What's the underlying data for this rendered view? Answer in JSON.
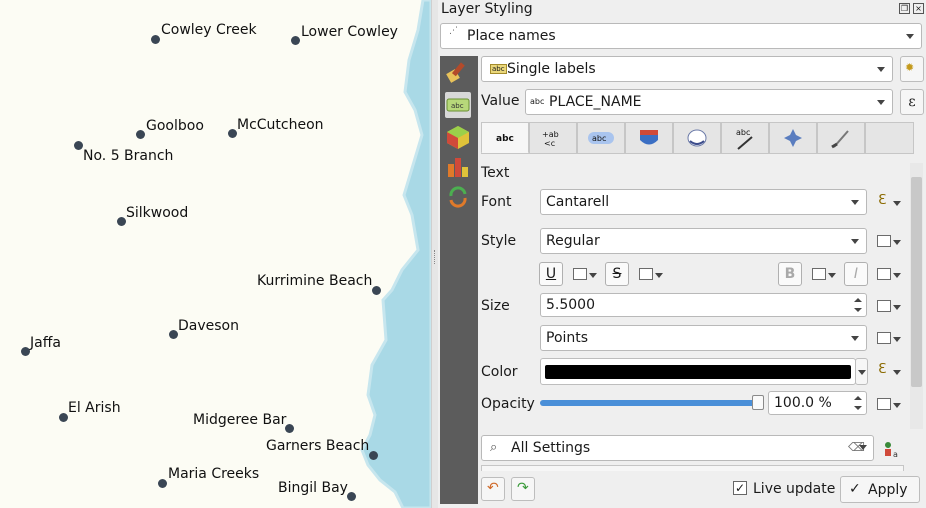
{
  "map": {
    "places": [
      {
        "name": "Cowley Creek"
      },
      {
        "name": "Lower Cowley"
      },
      {
        "name": "Goolboo"
      },
      {
        "name": "McCutcheon"
      },
      {
        "name": "No. 5 Branch"
      },
      {
        "name": "Silkwood"
      },
      {
        "name": "Kurrimine Beach"
      },
      {
        "name": "Daveson"
      },
      {
        "name": "Jaffa"
      },
      {
        "name": "El Arish"
      },
      {
        "name": "Midgeree Bar"
      },
      {
        "name": "Garners Beach"
      },
      {
        "name": "Maria Creeks"
      },
      {
        "name": "Bingil Bay"
      }
    ],
    "colors": {
      "land": "#fcfcf4",
      "water": "#a9d9e6",
      "dot": "#3a4654"
    }
  },
  "panel": {
    "title": "Layer Styling",
    "layer_combo": "Place names",
    "mode_combo": "Single labels",
    "value_label": "Value",
    "value_field": "PLACE_NAME",
    "value_field_icon": "abc",
    "expression_symbol": "ε",
    "tabs": [
      {
        "name": "text",
        "icon": "abc"
      },
      {
        "name": "formatting",
        "icon": "+ab"
      },
      {
        "name": "buffer",
        "icon": "abc"
      },
      {
        "name": "mask",
        "icon": "shield-icon"
      },
      {
        "name": "background",
        "icon": "background-icon"
      },
      {
        "name": "shadow",
        "icon": "abc"
      },
      {
        "name": "callouts",
        "icon": "callout-icon"
      },
      {
        "name": "placement",
        "icon": "placement-icon"
      },
      {
        "name": "rendering",
        "icon": "brush-icon"
      }
    ],
    "text_section": {
      "heading": "Text",
      "font_label": "Font",
      "font_value": "Cantarell",
      "style_label": "Style",
      "style_value": "Regular",
      "underline": "U",
      "strikeout": "S",
      "bold": "B",
      "italic": "I",
      "size_label": "Size",
      "size_value": "5.5000",
      "unit_value": "Points",
      "color_label": "Color",
      "color_value": "#000000",
      "opacity_label": "Opacity",
      "opacity_value": "100.0 %",
      "opacity_level": 1.0
    },
    "search_placeholder": "All Settings",
    "live_update_label": "Live update",
    "live_update_checked": true,
    "apply_label": "Apply"
  }
}
